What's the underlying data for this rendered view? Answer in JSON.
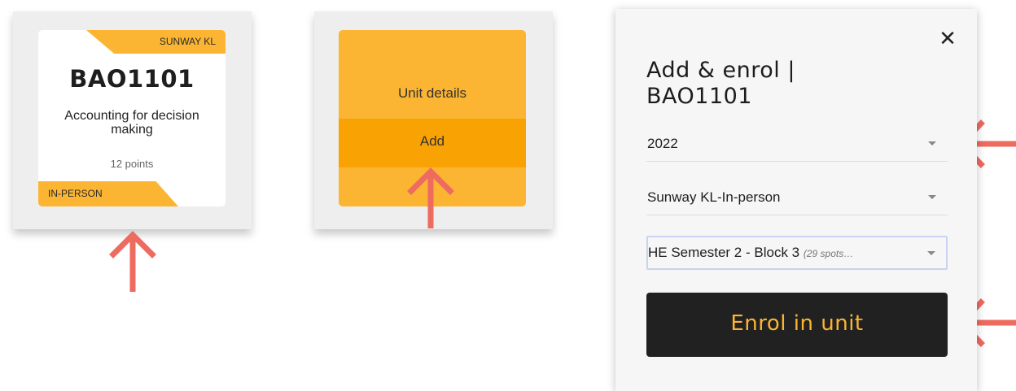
{
  "unit_card": {
    "campus": "SUNWAY KL",
    "code": "BAO1101",
    "name": "Accounting for decision making",
    "points": "12 points",
    "mode": "IN-PERSON"
  },
  "menu_card": {
    "details_label": "Unit details",
    "add_label": "Add"
  },
  "dialog": {
    "close_symbol": "✕",
    "title_line1": "Add & enrol |",
    "title_line2": "BAO1101",
    "year_value": "2022",
    "location_value": "Sunway KL-In-person",
    "teaching_period_value": "HE Semester 2 - Block 3",
    "teaching_period_hint": "(29 spots…",
    "enrol_label": "Enrol in unit"
  },
  "colors": {
    "accent_yellow": "#fbb533",
    "accent_orange": "#f9a203",
    "arrow_red": "#ee6b60",
    "button_dark": "#212121"
  },
  "icons": {
    "close": "close-icon",
    "dropdown": "chevron-down-icon",
    "pointer": "arrow-icon"
  }
}
